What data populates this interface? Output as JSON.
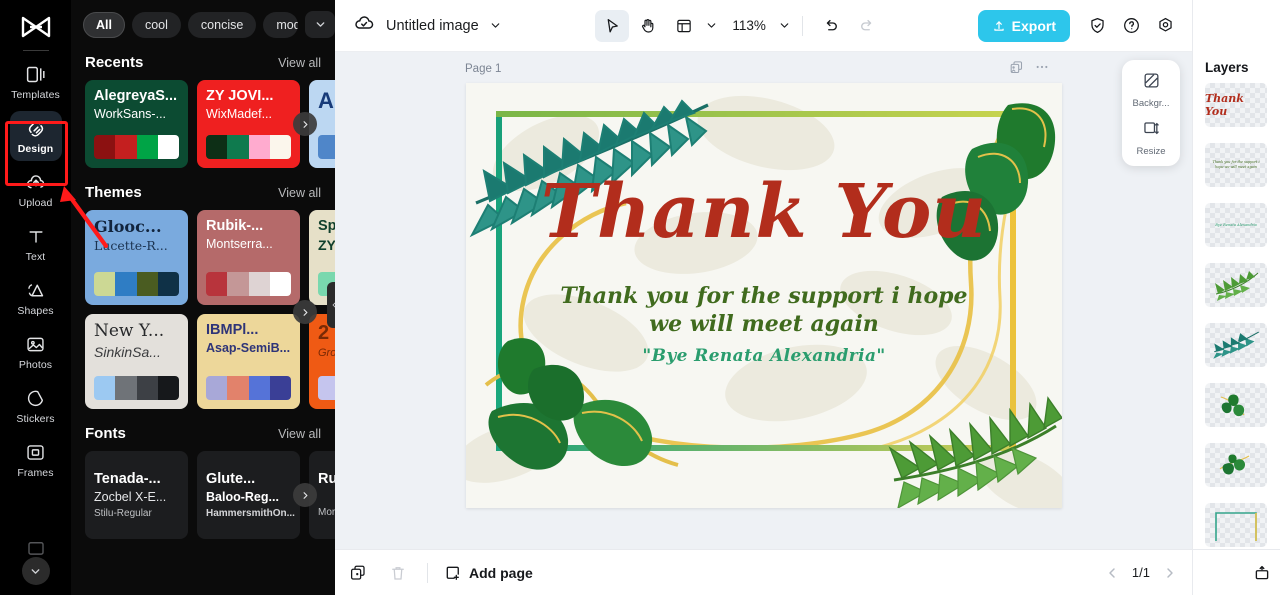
{
  "rail": {
    "logo_icon": "capcut-logo-icon",
    "items": [
      {
        "label": "Templates",
        "icon": "templates-icon",
        "active": false
      },
      {
        "label": "Design",
        "icon": "design-icon",
        "active": true
      },
      {
        "label": "Upload",
        "icon": "upload-cloud-icon",
        "active": false
      },
      {
        "label": "Text",
        "icon": "text-icon",
        "active": false
      },
      {
        "label": "Shapes",
        "icon": "shapes-icon",
        "active": false
      },
      {
        "label": "Photos",
        "icon": "photos-icon",
        "active": false
      },
      {
        "label": "Stickers",
        "icon": "stickers-icon",
        "active": false
      },
      {
        "label": "Frames",
        "icon": "frames-icon",
        "active": false
      }
    ],
    "collapse_icon": "chevron-down-icon"
  },
  "annotation": {
    "highlight_color": "#ff1a1a",
    "target": "Design"
  },
  "panel": {
    "chips": [
      {
        "label": "All",
        "selected": true
      },
      {
        "label": "cool",
        "selected": false
      },
      {
        "label": "concise",
        "selected": false
      },
      {
        "label": "modern",
        "selected": false
      }
    ],
    "chips_more_icon": "chevron-down-icon",
    "sections": [
      {
        "title": "Recents",
        "view_all": "View all",
        "cards": [
          {
            "line1": "AlegreyaS...",
            "line2": "WorkSans-...",
            "bg": "#0c4b32",
            "fg1": "#ffffff",
            "fg2": "#ffffff",
            "swatches": [
              "#8c1111",
              "#c41f1f",
              "#00a446",
              "#ffffff"
            ]
          },
          {
            "line1": "ZY JOVI...",
            "line2": "WixMadef...",
            "bg": "#ef2020",
            "fg1": "#ffffff",
            "fg2": "#ffffff",
            "swatches": [
              "#0d2f16",
              "#0f7a4e",
              "#ffabcf",
              "#fbf6ec"
            ]
          },
          {
            "line1": "A",
            "line2": "",
            "bg": "#bcd7f2",
            "fg1": "#183b79",
            "fg2": "#183b79",
            "swatches": [
              "#4f86c9",
              "#4f86c9",
              "#4f86c9",
              "#4f86c9"
            ]
          }
        ]
      },
      {
        "title": "Themes",
        "view_all": "View all",
        "cards": [
          {
            "line1": "Glooc...",
            "line2": "Lucette-R...",
            "bg": "#7aaade",
            "fg1": "#11243d",
            "fg2": "#1b3350",
            "serif": true,
            "swatches": [
              "#ccd894",
              "#2f7dc4",
              "#4a5c21",
              "#0f3147"
            ]
          },
          {
            "line1": "Rubik-...",
            "line2": "Montserra...",
            "bg": "#b56a6a",
            "fg1": "#ffffff",
            "fg2": "#ffffff",
            "swatches": [
              "#b8343c",
              "#c49797",
              "#ded3d3",
              "#ffffff"
            ]
          },
          {
            "line1": "Sp",
            "line2": "ZY",
            "bg": "#e6e0c8",
            "fg1": "#11402c",
            "fg2": "#11402c",
            "swatches": [
              "#79d8ae",
              "#79d8ae",
              "#79d8ae",
              "#79d8ae"
            ]
          },
          {
            "line1": "New Y...",
            "line2": "SinkinSa...",
            "bg": "#e3e0db",
            "fg1": "#27282a",
            "fg2": "#3a3b3d",
            "serif": true,
            "swatches": [
              "#9cc9f2",
              "#6f7378",
              "#3d4045",
              "#16181b"
            ]
          },
          {
            "line1": "IBMPl...",
            "line2": "Asap-SemiB...",
            "bg": "#edd79a",
            "fg1": "#2e3478",
            "fg2": "#2e3478",
            "swatches": [
              "#a8a8d8",
              "#e2826b",
              "#5573d8",
              "#3a3f96"
            ]
          },
          {
            "line1": "2",
            "line2": "Gro",
            "bg": "#ef5a14",
            "fg1": "#7a2a05",
            "fg2": "#7a2a05",
            "swatches": [
              "#c5c5ee",
              "#c5c5ee",
              "#c5c5ee",
              "#c5c5ee"
            ]
          }
        ]
      },
      {
        "title": "Fonts",
        "view_all": "View all",
        "cards": [
          {
            "line1": "Tenada-...",
            "line2": "Zocbel X-E...",
            "line3": "Stilu-Regular",
            "bg": "#1c1d1f",
            "fg1": "#ffffff",
            "fg2": "#e6e7e9",
            "fg3": "#bfc1c4"
          },
          {
            "line1": "Glute...",
            "line2": "Baloo-Reg...",
            "line3": "HammersmithOn...",
            "bg": "#1c1d1f",
            "fg1": "#ffffff",
            "fg2": "#ffffff",
            "fg3": "#d4d5d8"
          },
          {
            "line1": "Ru",
            "line2": "",
            "line3": "Mor",
            "bg": "#1c1d1f",
            "fg1": "#ffffff",
            "fg2": "#ffffff",
            "fg3": "#bfc1c4"
          }
        ]
      }
    ],
    "next_arrow_icon": "chevron-right-icon",
    "collapse_icon": "chevron-left-icon"
  },
  "topbar": {
    "cloud_icon": "cloud-saved-icon",
    "title": "Untitled image",
    "title_caret_icon": "chevron-down-icon",
    "tools": [
      {
        "name": "select-tool",
        "icon": "cursor-icon",
        "active": true
      },
      {
        "name": "hand-tool",
        "icon": "hand-icon",
        "active": false
      },
      {
        "name": "layout-tool",
        "icon": "layout-icon",
        "active": false
      }
    ],
    "layout_caret_icon": "chevron-down-icon",
    "zoom": "113%",
    "zoom_caret_icon": "chevron-down-icon",
    "undo_icon": "undo-icon",
    "redo_icon": "redo-icon",
    "export_label": "Export",
    "export_icon": "export-upload-icon",
    "export_color": "#2dc6eb",
    "shield_icon": "shield-check-icon",
    "help_icon": "help-circle-icon",
    "settings_icon": "settings-gear-icon"
  },
  "canvas": {
    "page_label": "Page 1",
    "duplicate_page_icon": "duplicate-page-icon",
    "more_icon": "more-horizontal-icon",
    "float_tools": [
      {
        "label": "Backgr...",
        "icon": "background-icon"
      },
      {
        "label": "Resize",
        "icon": "resize-icon"
      }
    ],
    "design": {
      "heading": "Thank You",
      "heading_color": "#b22d1c",
      "subtitle": "Thank you for the support i hope we will meet again",
      "subtitle_color": "#406b1e",
      "signature": "\"Bye  Renata Alexandria\"",
      "signature_color": "#2a9d6e",
      "frame_left_color": "#18a07a",
      "frame_right_color": "#f0c33a",
      "background_color": "#f7f7f2"
    }
  },
  "bottombar": {
    "duplicate_icon": "duplicate-icon",
    "delete_icon": "trash-icon",
    "add_page_label": "Add page",
    "add_page_icon": "add-page-icon",
    "prev_icon": "chevron-left-icon",
    "page_indicator": "1/1",
    "next_icon": "chevron-right-icon",
    "present_icon": "present-icon"
  },
  "layers": {
    "title": "Layers",
    "items": [
      {
        "name": "layer-thumb-thank-you-text",
        "kind": "text",
        "text": "Thank You",
        "color": "#b22d1c"
      },
      {
        "name": "layer-thumb-subtitle-text",
        "kind": "text",
        "text": "Thank you for the support i hope we will meet again",
        "color": "#406b1e"
      },
      {
        "name": "layer-thumb-signature-text",
        "kind": "text",
        "text": "Bye Renata Alexandria",
        "color": "#2a9d6e"
      },
      {
        "name": "layer-thumb-palm-leaf-green",
        "kind": "image",
        "text": "",
        "color": "#4f9b3a"
      },
      {
        "name": "layer-thumb-palm-leaf-teal",
        "kind": "image",
        "text": "",
        "color": "#1f7d72"
      },
      {
        "name": "layer-thumb-leaf-branch-top",
        "kind": "image",
        "text": "",
        "color": "#2d7a33"
      },
      {
        "name": "layer-thumb-leaf-branch-bottom",
        "kind": "image",
        "text": "",
        "color": "#2d7a33"
      },
      {
        "name": "layer-thumb-frame-border",
        "kind": "shape",
        "text": "",
        "color": "#18a07a"
      }
    ]
  }
}
